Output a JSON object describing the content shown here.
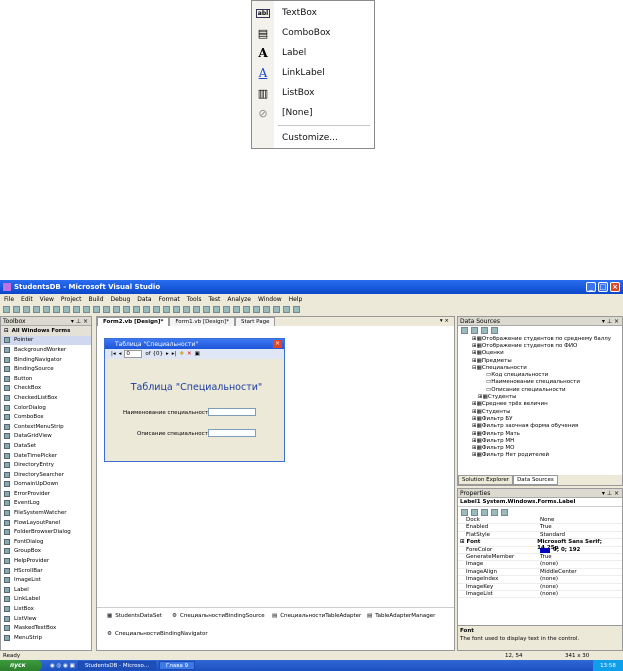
{
  "popup": {
    "items": [
      {
        "icon": "textbox-icon",
        "label": "TextBox"
      },
      {
        "icon": "combobox-icon",
        "label": "ComboBox"
      },
      {
        "icon": "label-icon",
        "label": "Label"
      },
      {
        "icon": "linklabel-icon",
        "label": "LinkLabel"
      },
      {
        "icon": "listbox-icon",
        "label": "ListBox"
      },
      {
        "icon": "none-icon",
        "label": "[None]"
      }
    ],
    "customize": "Customize..."
  },
  "window": {
    "title": "StudentsDB - Microsoft Visual Studio"
  },
  "menu": [
    "File",
    "Edit",
    "View",
    "Project",
    "Build",
    "Debug",
    "Data",
    "Format",
    "Tools",
    "Test",
    "Analyze",
    "Window",
    "Help"
  ],
  "toolbox": {
    "title": "Toolbox",
    "group": "All Windows Forms",
    "items": [
      "Pointer",
      "BackgroundWorker",
      "BindingNavigator",
      "BindingSource",
      "Button",
      "CheckBox",
      "CheckedListBox",
      "ColorDialog",
      "ComboBox",
      "ContextMenuStrip",
      "DataGridView",
      "DataSet",
      "DateTimePicker",
      "DirectoryEntry",
      "DirectorySearcher",
      "DomainUpDown",
      "ErrorProvider",
      "EventLog",
      "FileSystemWatcher",
      "FlowLayoutPanel",
      "FolderBrowserDialog",
      "FontDialog",
      "GroupBox",
      "HelpProvider",
      "HScrollBar",
      "ImageList",
      "Label",
      "LinkLabel",
      "ListBox",
      "ListView",
      "MaskedTextBox",
      "MenuStrip"
    ]
  },
  "tabs": [
    "Form2.vb [Design]*",
    "Form1.vb [Design]*",
    "Start Page"
  ],
  "form": {
    "title": "Таблица \"Специальности\"",
    "nav_pos": "0",
    "nav_of": "of {0}",
    "heading": "Таблица \"Специальности\"",
    "label1": "Наименование специальности:",
    "label2": "Описание специальности:"
  },
  "tray": [
    "StudentsDataSet",
    "СпециальностиBindingSource",
    "СпециальностиTableAdapter",
    "TableAdapterManager",
    "СпециальностиBindingNavigator"
  ],
  "datasources": {
    "title": "Data Sources",
    "items": [
      "Отображение студентов по среднему баллу",
      "Отображение студентов по ФИО",
      "Оценки",
      "Предметы",
      "Специальности",
      "Код специальности",
      "Наименование специальности",
      "Описание специальности",
      "Студенты",
      "Среднее трёх величин",
      "Студенты",
      "Фильтр БУ",
      "Фильтр заочная форма обучения",
      "Фильтр Мать",
      "Фильтр МН",
      "Фильтр МО",
      "Фильтр Нет родителей"
    ],
    "tab1": "Solution Explorer",
    "tab2": "Data Sources"
  },
  "properties": {
    "title": "Properties",
    "object": "Label1 System.Windows.Forms.Label",
    "rows": [
      [
        "Dock",
        "None"
      ],
      [
        "Enabled",
        "True"
      ],
      [
        "FlatStyle",
        "Standard"
      ],
      [
        "Font",
        "Microsoft Sans Serif; 14,25p"
      ],
      [
        "ForeColor",
        "0; 0; 192"
      ],
      [
        "GenerateMember",
        "True"
      ],
      [
        "Image",
        "(none)"
      ],
      [
        "ImageAlign",
        "MiddleCenter"
      ],
      [
        "ImageIndex",
        "(none)"
      ],
      [
        "ImageKey",
        "(none)"
      ],
      [
        "ImageList",
        "(none)"
      ]
    ],
    "desc_title": "Font",
    "desc": "The font used to display text in the control."
  },
  "status": {
    "text": "Ready",
    "pos": "12, 54",
    "size": "341 x 30"
  },
  "taskbar": {
    "start": "пуск",
    "tasks": [
      "StudentsDB - Microso...",
      "Глава 9"
    ],
    "clock": "13:58"
  }
}
